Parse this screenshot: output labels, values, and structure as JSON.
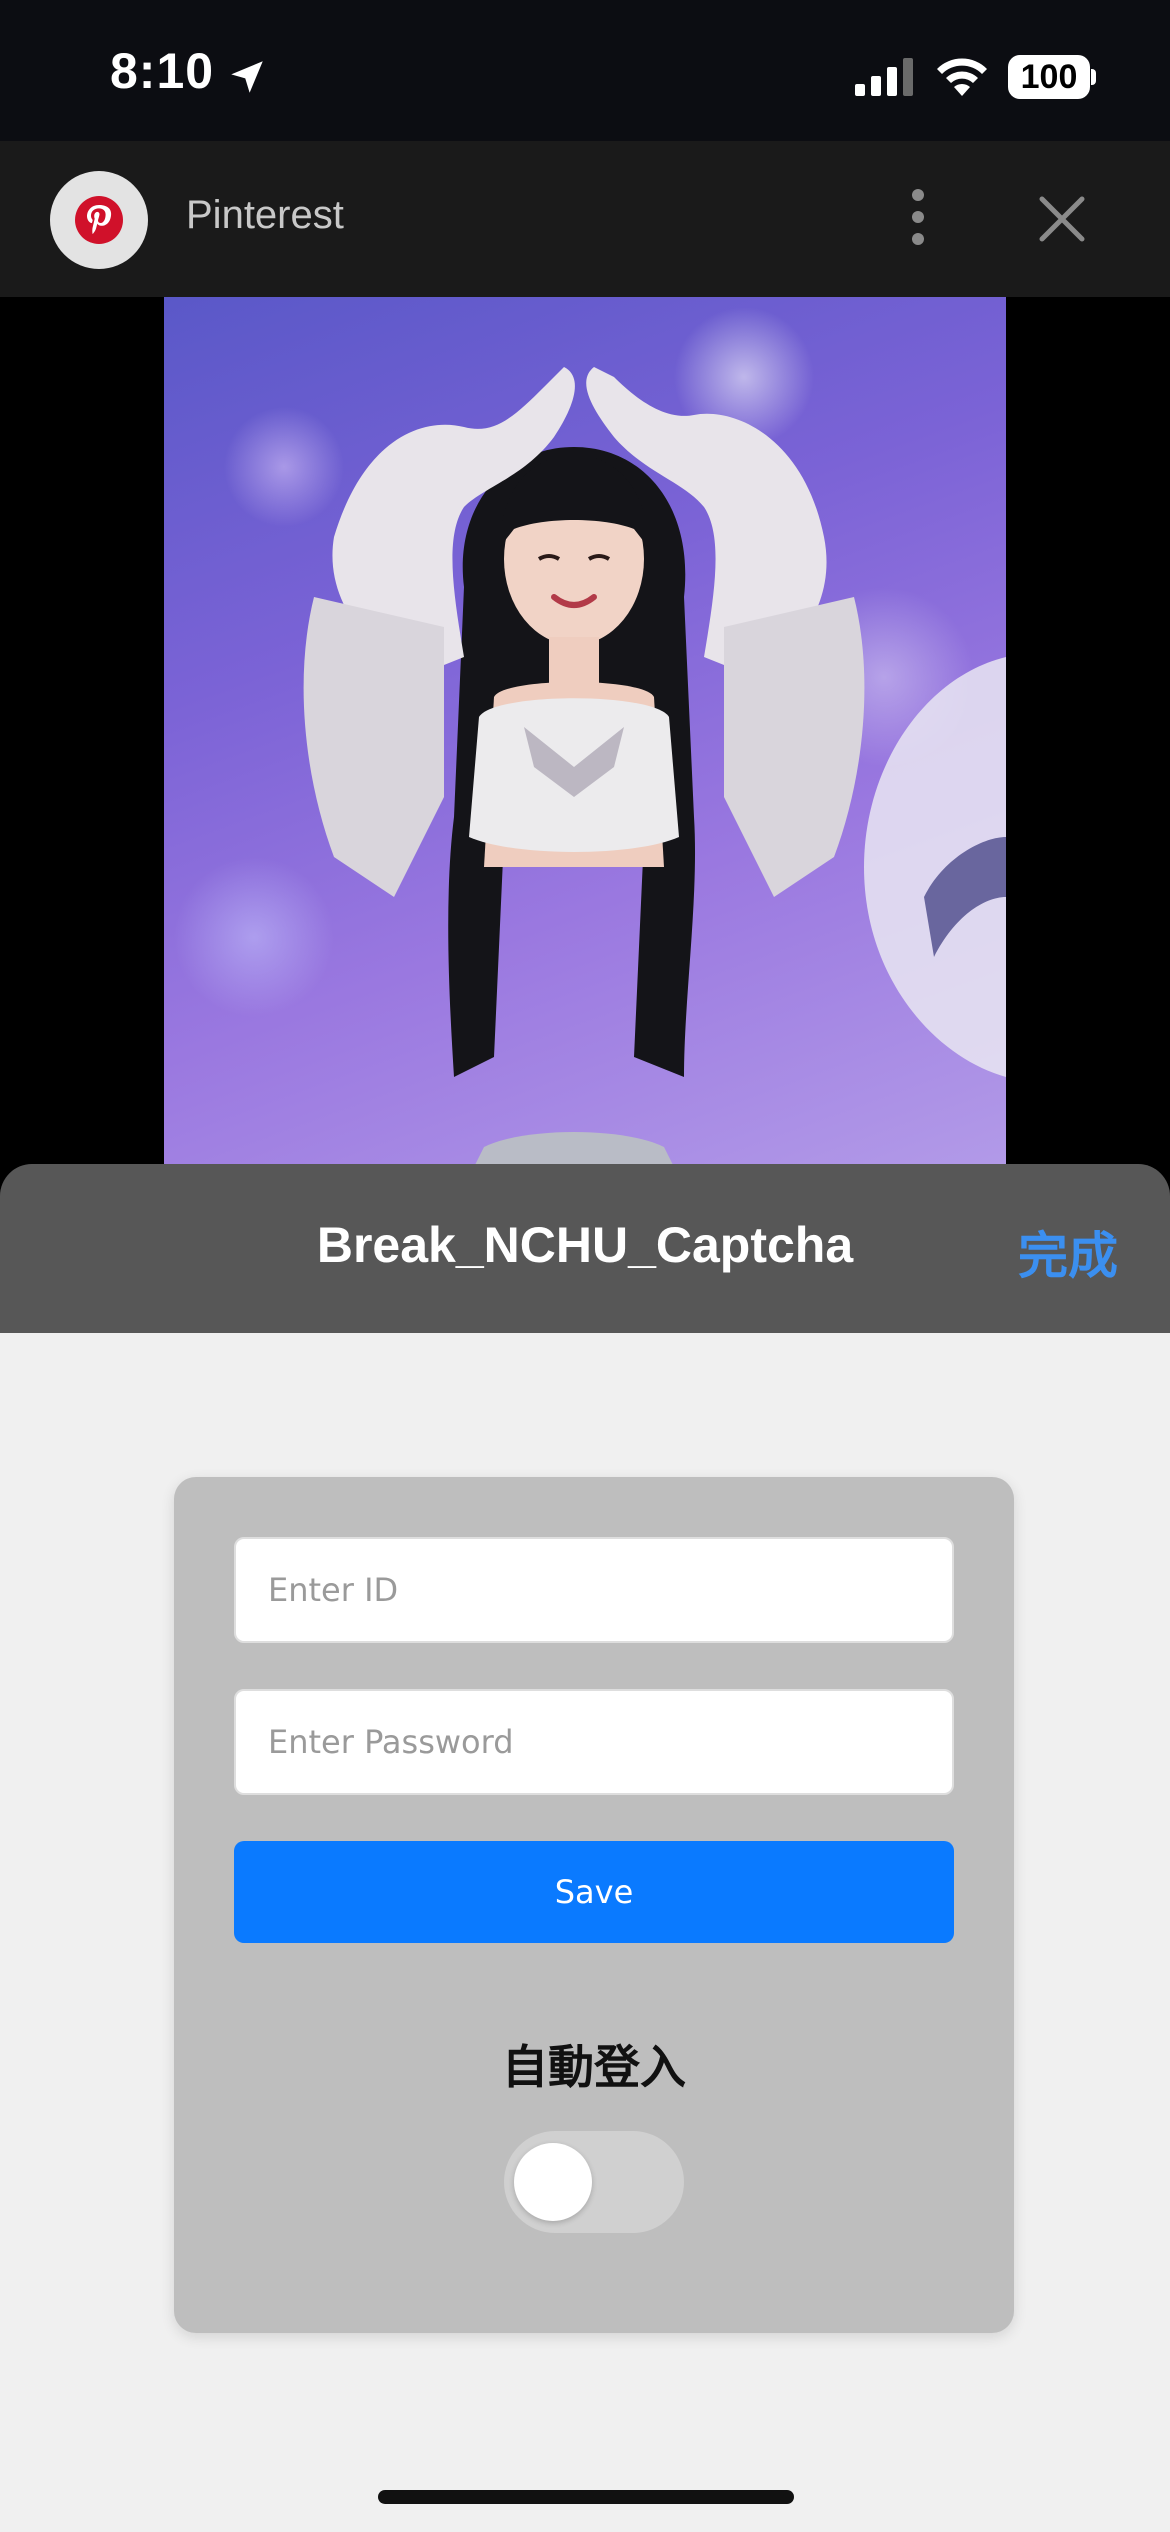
{
  "status_bar": {
    "time": "8:10",
    "battery": "100",
    "icons": [
      "location-arrow-icon",
      "cellular-signal-icon",
      "wifi-icon",
      "battery-icon"
    ]
  },
  "header": {
    "app_name": "Pinterest",
    "icons": [
      "pinterest-logo-icon",
      "more-vertical-icon",
      "close-icon"
    ]
  },
  "photo": {
    "description_icon": "photo"
  },
  "sheet": {
    "title": "Break_NCHU_Captcha",
    "done_label": "完成"
  },
  "form": {
    "id_placeholder": "Enter ID",
    "id_value": "",
    "password_placeholder": "Enter Password",
    "password_value": "",
    "save_label": "Save",
    "auto_login_label": "自動登入",
    "auto_login_enabled": false
  },
  "colors": {
    "accent": "#0a7aff",
    "done": "#3b8ff0",
    "pinterest": "#d0112a"
  }
}
